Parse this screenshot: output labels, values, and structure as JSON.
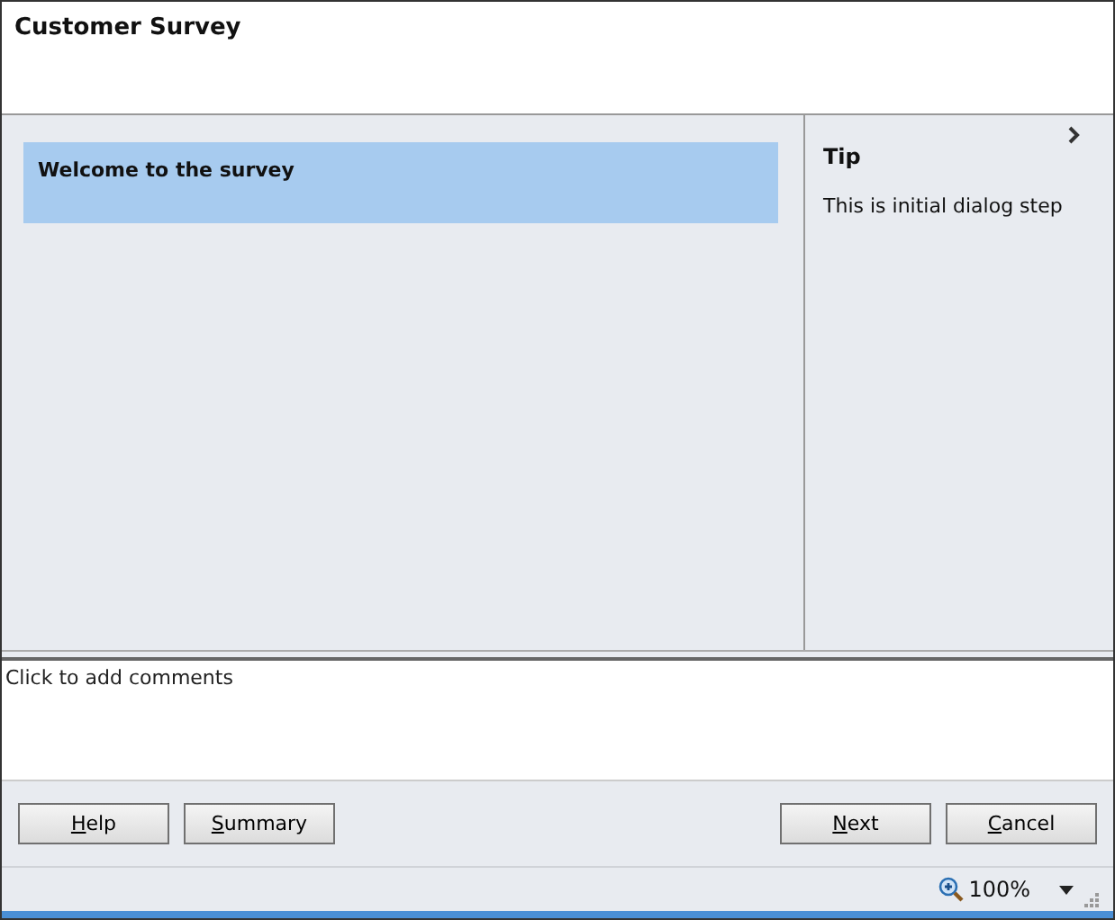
{
  "window": {
    "title": "Customer Survey"
  },
  "step": {
    "heading": "Welcome to the survey"
  },
  "tip": {
    "title": "Tip",
    "text": "This is initial dialog step"
  },
  "comments": {
    "placeholder": "Click to add comments"
  },
  "buttons_left": [
    {
      "label": "Help"
    },
    {
      "label": "Summary"
    }
  ],
  "buttons_right": [
    {
      "label": "Next"
    },
    {
      "label": "Cancel"
    }
  ],
  "status_bar": {
    "zoom": "100%"
  }
}
